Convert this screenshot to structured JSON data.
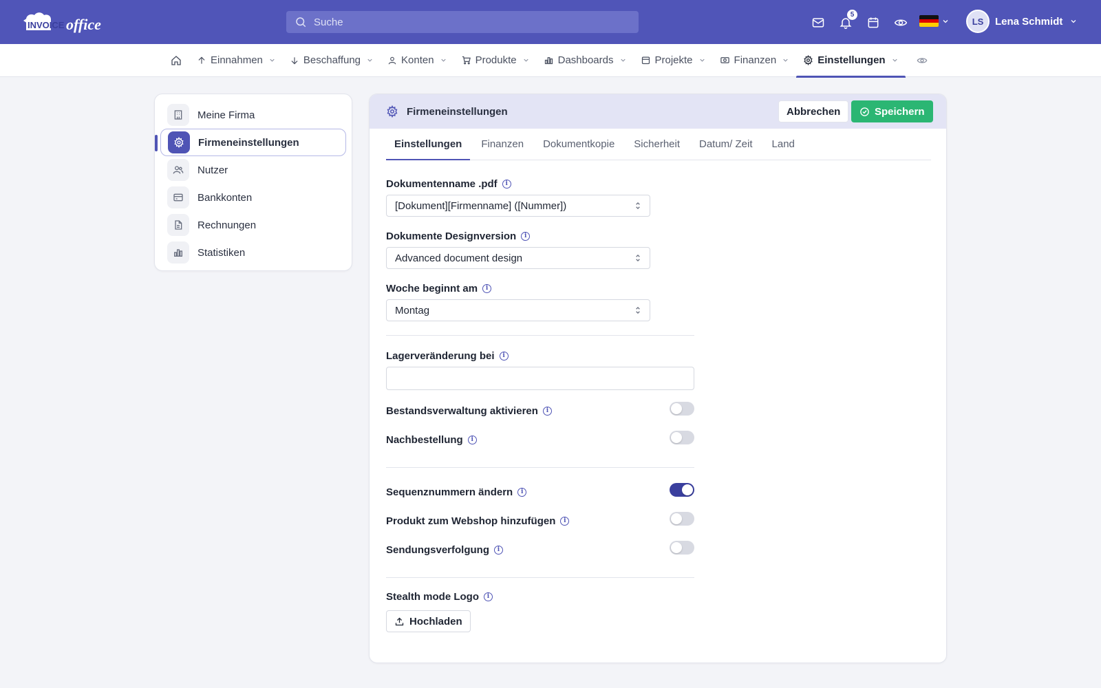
{
  "app": {
    "logo_text_1": "INVOICE",
    "logo_text_2": "office"
  },
  "search": {
    "placeholder": "Suche"
  },
  "notifications": {
    "count": "5"
  },
  "user": {
    "initials": "LS",
    "name": "Lena Schmidt"
  },
  "nav": {
    "items": [
      {
        "label": "Einnahmen",
        "icon": "arrow-up-icon"
      },
      {
        "label": "Beschaffung",
        "icon": "arrow-down-icon"
      },
      {
        "label": "Konten",
        "icon": "user-icon"
      },
      {
        "label": "Produkte",
        "icon": "cart-icon"
      },
      {
        "label": "Dashboards",
        "icon": "bar-chart-icon"
      },
      {
        "label": "Projekte",
        "icon": "calendar-icon"
      },
      {
        "label": "Finanzen",
        "icon": "money-icon"
      },
      {
        "label": "Einstellungen",
        "icon": "gear-icon"
      }
    ],
    "active": "Einstellungen"
  },
  "sidebar": {
    "items": [
      {
        "label": "Meine Firma",
        "icon": "building-icon"
      },
      {
        "label": "Firmeneinstellungen",
        "icon": "gear-icon"
      },
      {
        "label": "Nutzer",
        "icon": "users-icon"
      },
      {
        "label": "Bankkonten",
        "icon": "credit-card-icon"
      },
      {
        "label": "Rechnungen",
        "icon": "document-icon"
      },
      {
        "label": "Statistiken",
        "icon": "bar-chart-icon"
      }
    ],
    "active": "Firmeneinstellungen"
  },
  "panel": {
    "title": "Firmeneinstellungen",
    "cancel_label": "Abbrechen",
    "save_label": "Speichern",
    "tabs": [
      "Einstellungen",
      "Finanzen",
      "Dokumentkopie",
      "Sicherheit",
      "Datum/ Zeit",
      "Land"
    ],
    "active_tab": "Einstellungen"
  },
  "form": {
    "doc_name_label": "Dokumentenname .pdf",
    "doc_name_value": "[Dokument][Firmenname] ([Nummer])",
    "design_label": "Dokumente Designversion",
    "design_value": "Advanced document design",
    "week_label": "Woche beginnt am",
    "week_value": "Montag",
    "stock_change_label": "Lagerveränderung bei",
    "stock_change_value": "",
    "inventory_label": "Bestandsverwaltung aktivieren",
    "inventory_on": false,
    "reorder_label": "Nachbestellung",
    "reorder_on": false,
    "sequence_label": "Sequenznummern ändern",
    "sequence_on": true,
    "webshop_label": "Produkt zum Webshop hinzufügen",
    "webshop_on": false,
    "tracking_label": "Sendungsverfolgung",
    "tracking_on": false,
    "stealth_label": "Stealth mode Logo",
    "upload_label": "Hochladen"
  },
  "colors": {
    "topbar": "#5055b8",
    "accent": "#4f54b5",
    "save": "#2bb673"
  }
}
